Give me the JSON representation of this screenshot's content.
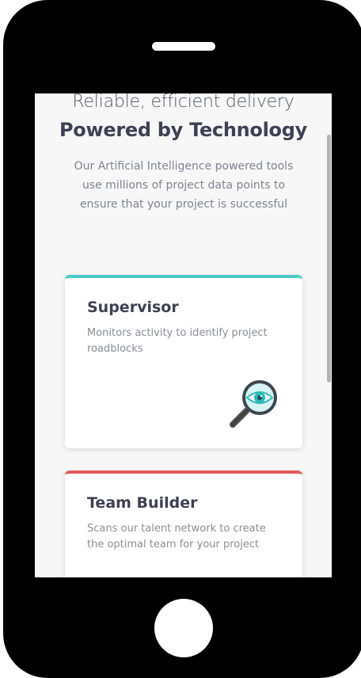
{
  "hero": {
    "tagline": "Reliable, efficient delivery",
    "headline": "Powered by Technology",
    "description": "Our Artificial Intelligence powered tools use millions of project data points to ensure that your project is successful"
  },
  "cards": [
    {
      "title": "Supervisor",
      "description": "Monitors activity to identify project roadblocks",
      "accent_color": "#4cc9c7",
      "icon": "magnifier-eye-icon"
    },
    {
      "title": "Team Builder",
      "description": "Scans our talent network to create the optimal team for your project",
      "accent_color": "#e25b5b",
      "icon": ""
    }
  ]
}
